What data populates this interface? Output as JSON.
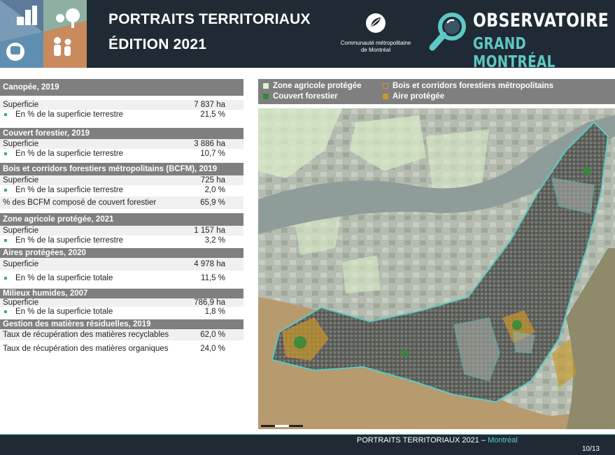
{
  "header": {
    "title_line1": "PORTRAITS TERRITORIAUX",
    "title_line2": "ÉDITION 2021",
    "cmm_line1": "Communauté métropolitaine",
    "cmm_line2": "de Montréal",
    "observatoire_line1": "OBSERVATOIRE",
    "observatoire_line2": "GRAND MONTRÉAL",
    "badge_icons": [
      "buildings-icon",
      "tree-icon",
      "people-icon",
      "train-icon"
    ]
  },
  "sections": [
    {
      "title": "Canopée, 2019",
      "rows": [
        {
          "label": "Superficie",
          "value": "7 837 ha",
          "bullet": false
        },
        {
          "label": "En % de la superficie terrestre",
          "value": "21,5 %",
          "bullet": true
        }
      ]
    },
    {
      "title": "Couvert forestier, 2019",
      "rows": [
        {
          "label": "Superficie",
          "value": "3 886 ha",
          "bullet": false
        },
        {
          "label": "En % de la superficie terrestre",
          "value": "10,7 %",
          "bullet": true
        }
      ]
    },
    {
      "title": "Bois et corridors forestiers métropolitains (BCFM), 2019",
      "rows": [
        {
          "label": "Superficie",
          "value": "725 ha",
          "bullet": false
        },
        {
          "label": "En % de la superficie terrestre",
          "value": "2,0 %",
          "bullet": true
        },
        {
          "label": "% des BCFM composé de couvert forestier",
          "value": "65,9 %",
          "bullet": false
        }
      ]
    },
    {
      "title": "Zone agricole protégée, 2021",
      "rows": [
        {
          "label": "Superficie",
          "value": "1 157 ha",
          "bullet": false
        },
        {
          "label": "En % de la superficie terrestre",
          "value": "3,2 %",
          "bullet": true
        }
      ]
    },
    {
      "title": "Aires protégées, 2020",
      "rows": [
        {
          "label": "Superficie",
          "value": "4 978 ha",
          "bullet": false
        },
        {
          "label": "En % de la superficie totale",
          "value": "11,5 %",
          "bullet": true
        }
      ]
    },
    {
      "title": "Milieux humides, 2007",
      "rows": [
        {
          "label": "Superficie",
          "value": "786,9 ha",
          "bullet": false
        },
        {
          "label": "En % de la superficie totale",
          "value": "1,8 %",
          "bullet": true
        }
      ]
    },
    {
      "title": "Gestion des matières résiduelles, 2019",
      "rows": [
        {
          "label": "Taux de récupération des matières recyclables",
          "value": "62,0 %",
          "bullet": false
        },
        {
          "label": "Taux de récupération des matières organiques",
          "value": "24,0 %",
          "bullet": false
        }
      ]
    }
  ],
  "legend": [
    {
      "label": "Zone agricole protégée",
      "color": "#dff0d0",
      "style": "fill"
    },
    {
      "label": "Bois et corridors forestiers métropolitains",
      "color": "#e8893a",
      "style": "outline"
    },
    {
      "label": "Couvert forestier",
      "color": "#2e8b3a",
      "style": "fill"
    },
    {
      "label": "Aire protégée",
      "color": "#c7982a",
      "style": "fill"
    }
  ],
  "colors": {
    "header_bg": "#1f2a35",
    "accent_teal": "#5ec9c4",
    "section_header_bg": "#7f7f7f"
  },
  "footer": {
    "text": "PORTRAITS TERRITORIAUX 2021 – ",
    "city": "Montréal",
    "page": "10/13"
  }
}
